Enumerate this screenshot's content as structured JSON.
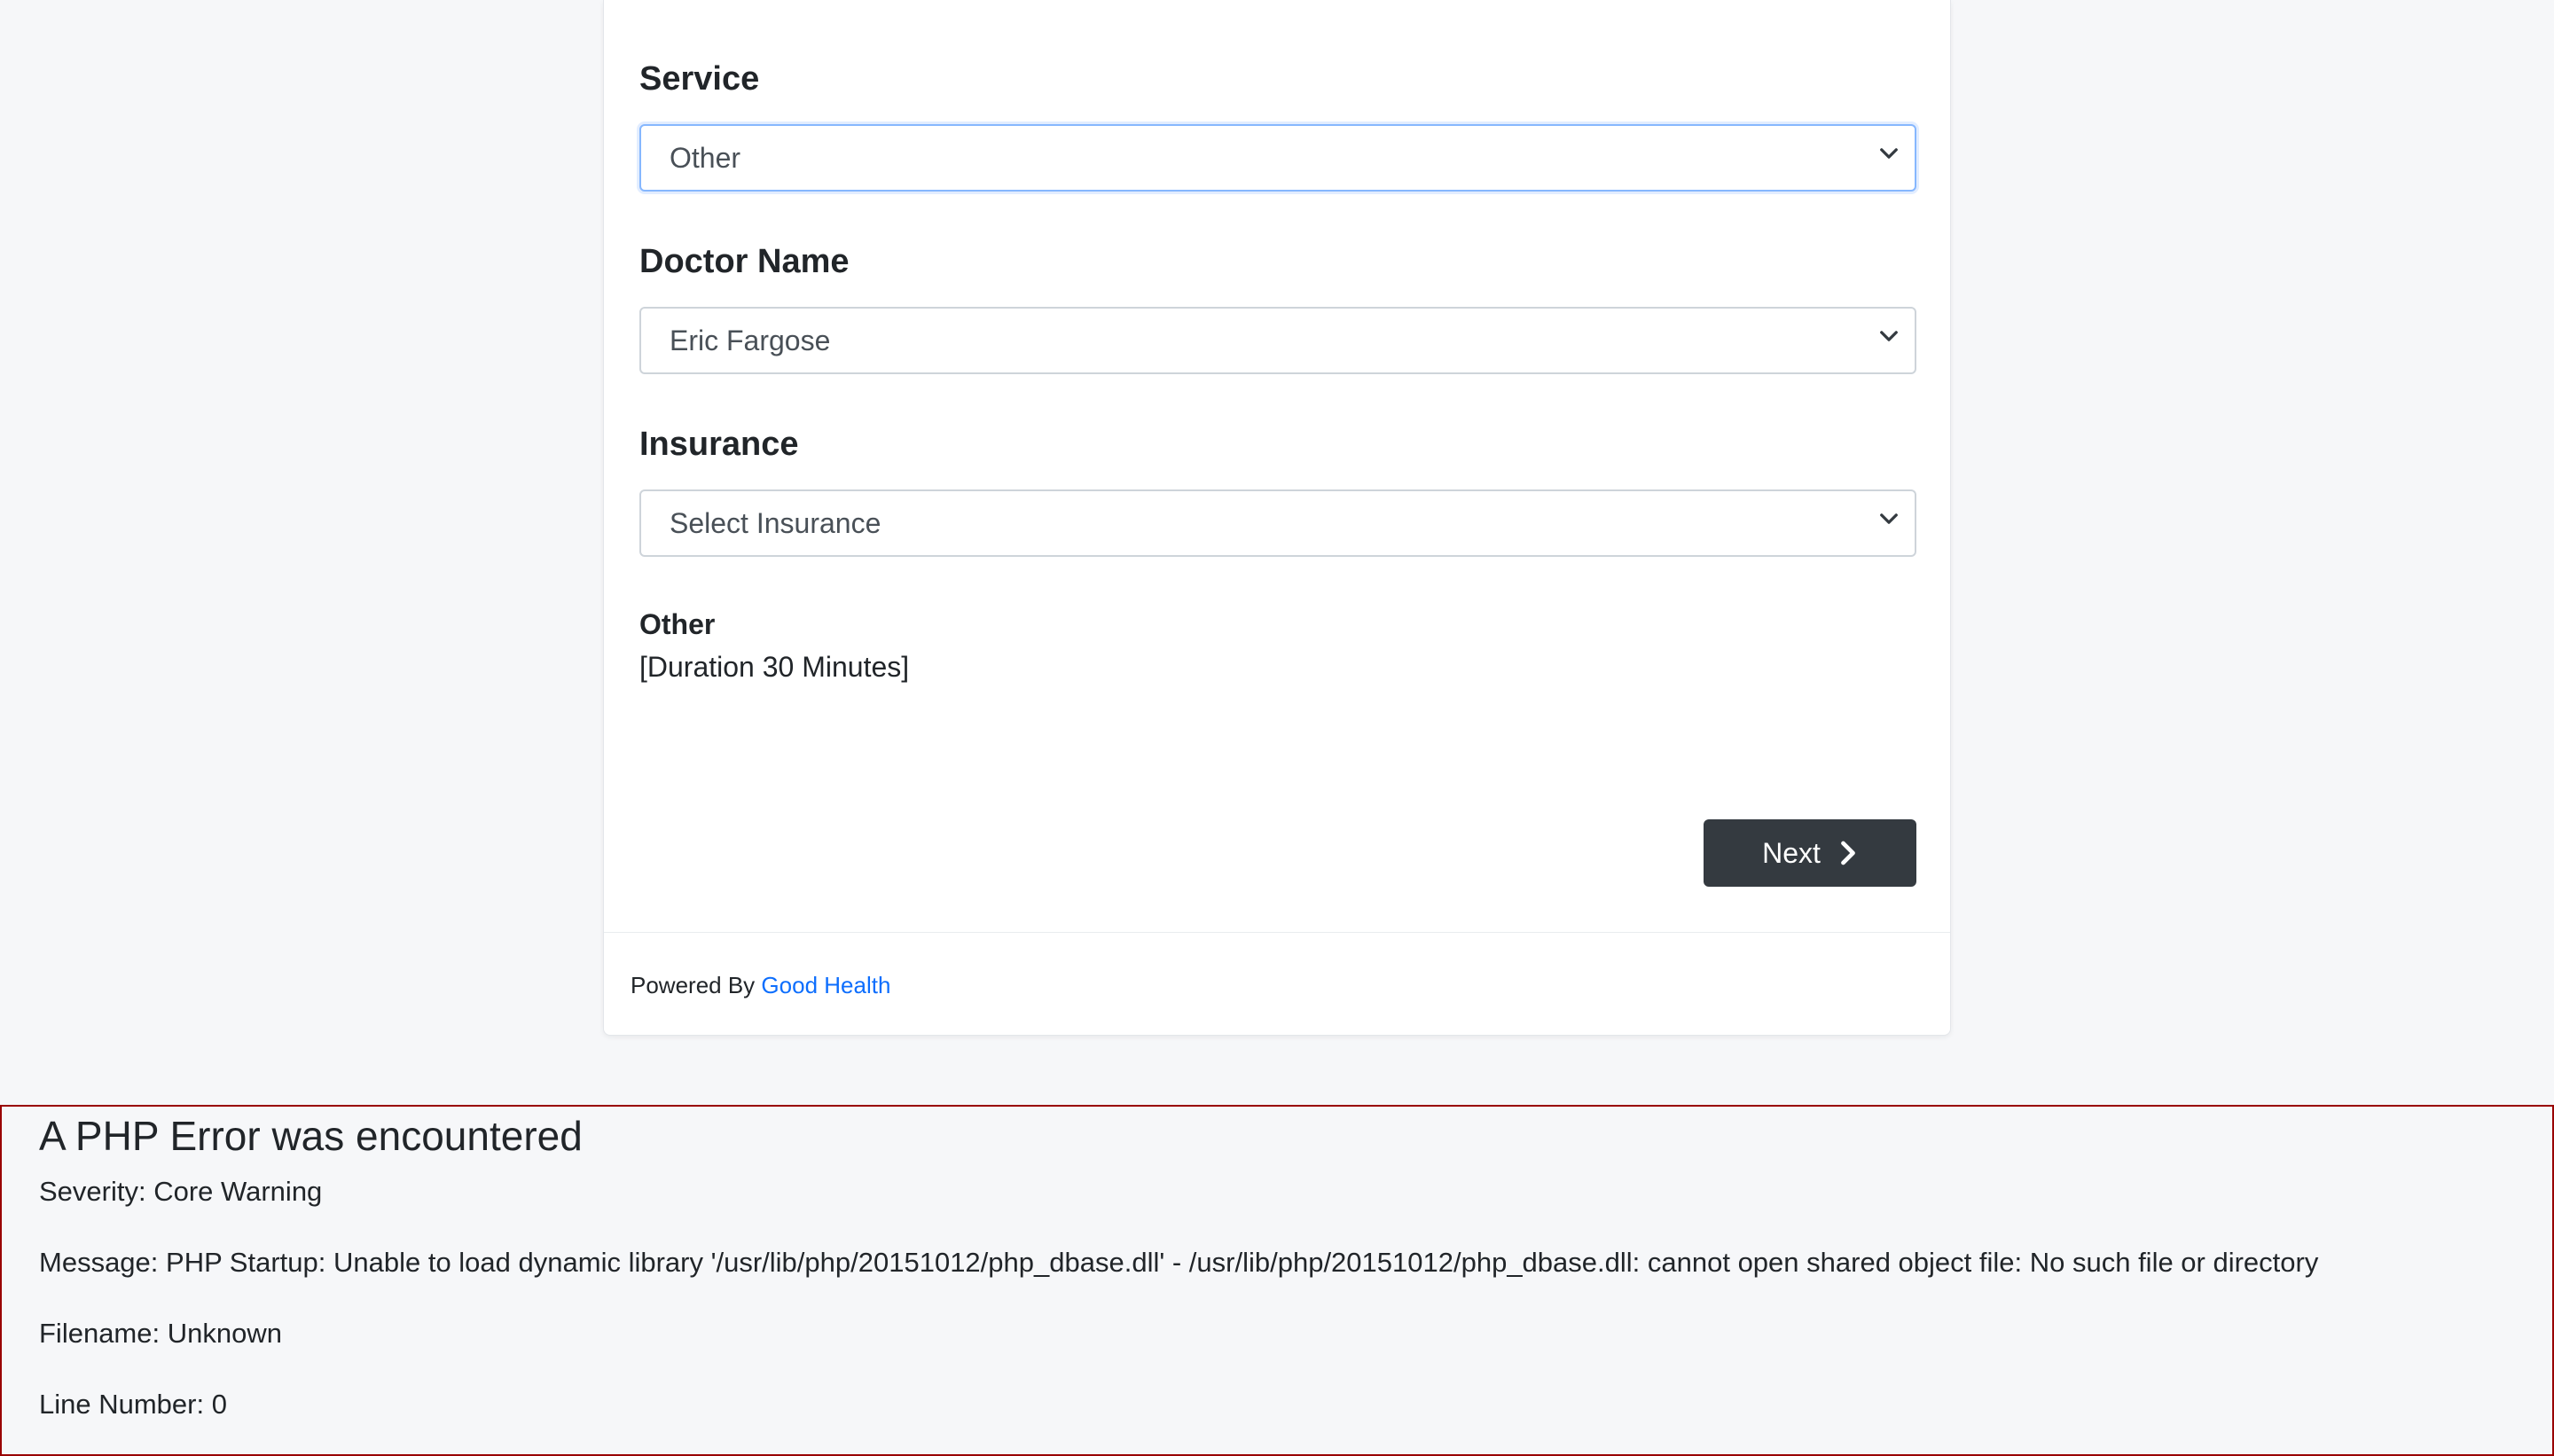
{
  "form": {
    "service": {
      "label": "Service",
      "selected": "Other"
    },
    "doctor": {
      "label": "Doctor Name",
      "selected": "Eric Fargose"
    },
    "insurance": {
      "label": "Insurance",
      "selected": "Select Insurance"
    },
    "summary": {
      "title": "Other",
      "duration": "[Duration 30 Minutes]"
    },
    "next_label": "Next"
  },
  "footer": {
    "powered_by": "Powered By",
    "brand_link": "Good Health"
  },
  "php_error": {
    "title": "A PHP Error was encountered",
    "severity": "Severity: Core Warning",
    "message": "Message: PHP Startup: Unable to load dynamic library '/usr/lib/php/20151012/php_dbase.dll' - /usr/lib/php/20151012/php_dbase.dll: cannot open shared object file: No such file or directory",
    "filename": "Filename: Unknown",
    "line_number": "Line Number: 0"
  },
  "colors": {
    "page_bg": "#f6f7f9",
    "button_bg": "#343a40",
    "link": "#0d6efd",
    "error_border": "#990000"
  },
  "icons": {
    "select_chevron": "chevron-down-icon",
    "next_chevron": "chevron-right-icon"
  }
}
